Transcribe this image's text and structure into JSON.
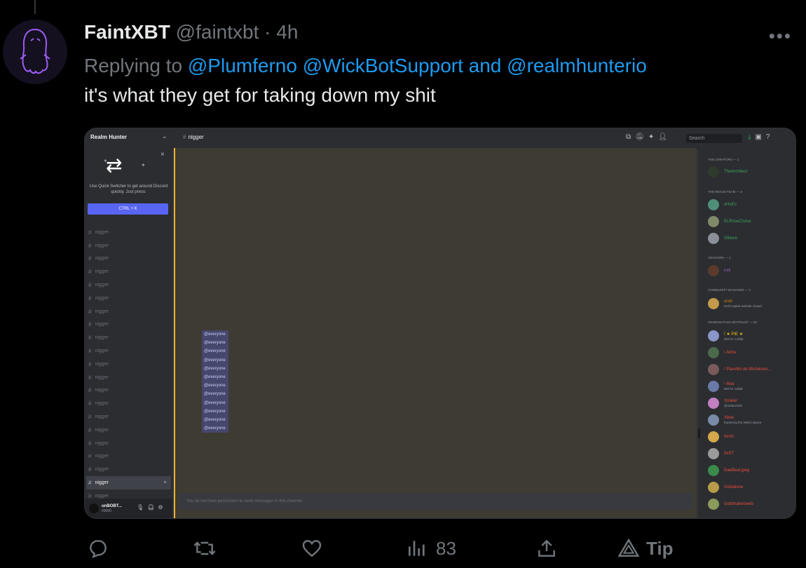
{
  "tweet": {
    "display_name": "FaintXBT",
    "handle": "@faintxbt",
    "separator": "·",
    "time": "4h",
    "more_icon": "more-icon",
    "replying_prefix": "Replying to",
    "replying_mentions": [
      "@Plumferno",
      "@WickBotSupport",
      "and",
      "@realmhunterio"
    ],
    "text": "it's what they get for taking down my shit"
  },
  "discord": {
    "server_name": "Realm Hunter",
    "channel_name": "nigger",
    "search_placeholder": "Search",
    "quick_switcher": {
      "text": "Use Quick Switcher to get around Discord quickly. Just press:",
      "shortcut": "CTRL + K"
    },
    "channels": [
      "nigger",
      "nigger",
      "nigger",
      "nigger",
      "nigger",
      "nigger",
      "nigger",
      "nigger",
      "nigger",
      "nigger",
      "nigger",
      "nigger",
      "nigger",
      "nigger",
      "nigger",
      "nigger",
      "nigger",
      "nigger",
      "nigger",
      "nigger",
      "nigger"
    ],
    "active_channel_index": 19,
    "user": {
      "name": "unBOBT...",
      "tag": "#0000"
    },
    "mentions": [
      "@everyone",
      "@everyone",
      "@everyone",
      "@everyone",
      "@everyone",
      "@everyone",
      "@everyone",
      "@everyone",
      "@everyone",
      "@everyone",
      "@everyone",
      "@everyone"
    ],
    "message_placeholder": "You do not have permission to send messages in this channel.",
    "member_roles": [
      {
        "title": "THE CREATORS — 1"
      },
      {
        "title": "THE REALM TEAM — 3"
      },
      {
        "title": "ADVISORS — 1"
      },
      {
        "title": "COMMUNITY MANAGER — 1"
      },
      {
        "title": "GENESIS PASS WHITELIST — 82"
      }
    ],
    "members": [
      {
        "name": "TheArchitect",
        "status": "",
        "color": "#3ba55c",
        "avatar_color": "#2e3b2a"
      },
      {
        "name": "xHxEn",
        "status": "",
        "color": "#3ba55c",
        "avatar_color": "#4f8f7a"
      },
      {
        "name": "ELRoseCruise",
        "status": "",
        "color": "#3ba55c",
        "avatar_color": "#7f8a6a"
      },
      {
        "name": "Ollarus",
        "status": "",
        "color": "#3ba55c",
        "avatar_color": "#8a8f99"
      },
      {
        "name": "nail",
        "status": "",
        "color": "#9b59b6",
        "avatar_color": "#5a3a2a"
      },
      {
        "name": "arab",
        "status": "Hell Capital website closed",
        "color": "#c27c0e",
        "avatar_color": "#c49a4a"
      },
      {
        "name": "! ★ PIE ★",
        "status": "DM for Collab",
        "color": "#f1c40f",
        "avatar_color": "#8a95c8"
      },
      {
        "name": "! Aktra",
        "status": "",
        "color": "#e74c3c",
        "avatar_color": "#4a6a4a"
      },
      {
        "name": "! Plandito de Michelsen...",
        "status": "",
        "color": "#e74c3c",
        "avatar_color": "#7a5a5a"
      },
      {
        "name": "! Mao",
        "status": "DM for collab",
        "color": "#e74c3c",
        "avatar_color": "#6a7aa8"
      },
      {
        "name": "Xtraker",
        "status": "@xtraker333",
        "color": "#e74c3c",
        "avatar_color": "#c27fc2"
      },
      {
        "name": "Xbrie",
        "status": "Exploring the Web3 Space",
        "color": "#e74c3c",
        "avatar_color": "#7a8aa8"
      },
      {
        "name": "0xVic",
        "status": "",
        "color": "#e74c3c",
        "avatar_color": "#d4a74a"
      },
      {
        "name": "0xST",
        "status": "",
        "color": "#e74c3c",
        "avatar_color": "#9a9a9a"
      },
      {
        "name": "DaeBeat.jpeg",
        "status": "",
        "color": "#e74c3c",
        "avatar_color": "#3a8a4a"
      },
      {
        "name": "Goldalune",
        "status": "",
        "color": "#e74c3c",
        "avatar_color": "#b89a4a"
      },
      {
        "name": "Goldmakenweb",
        "status": "",
        "color": "#e74c3c",
        "avatar_color": "#8a9a5a"
      }
    ]
  },
  "actions": {
    "reply_icon": "reply-icon",
    "retweet_icon": "retweet-icon",
    "like_icon": "like-icon",
    "views_icon": "views-icon",
    "views_count": "83",
    "share_icon": "share-icon",
    "tip_label": "Tip"
  }
}
